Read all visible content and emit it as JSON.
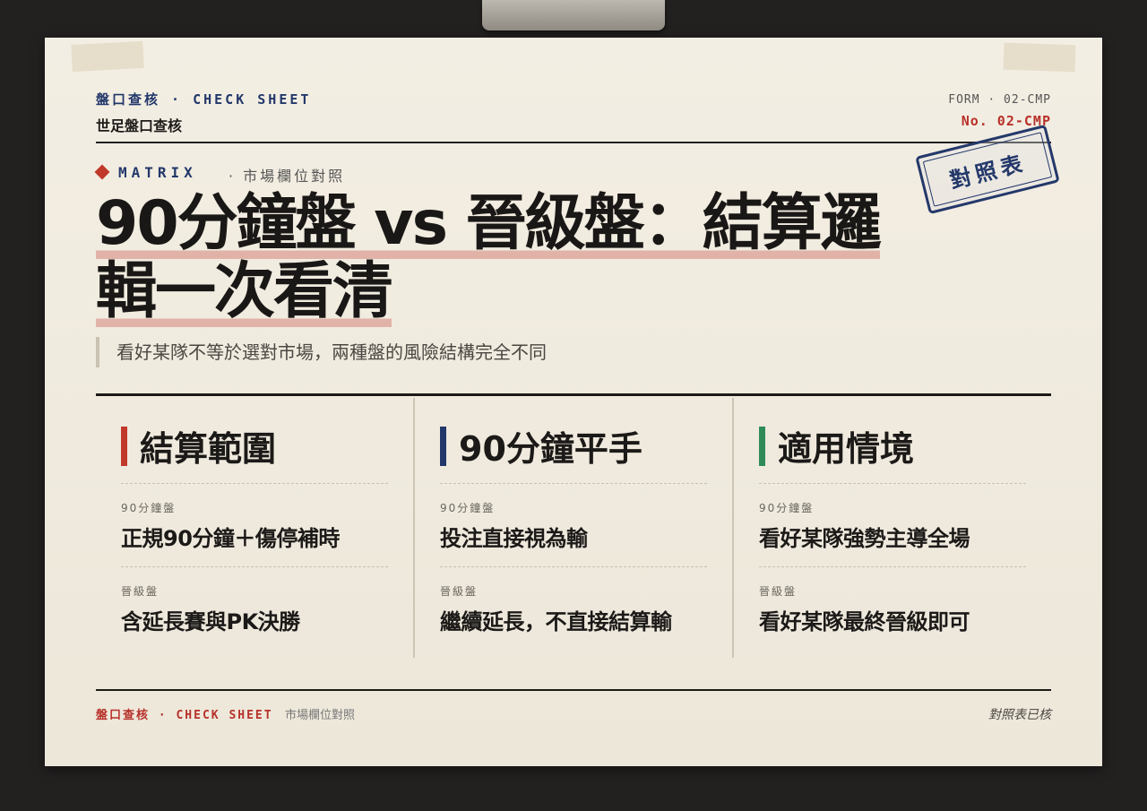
{
  "header": {
    "tag": "盤口查核 · CHECK SHEET",
    "subtitle": "世足盤口查核",
    "form_id": "FORM · 02-CMP",
    "form_no": "No. 02-CMP"
  },
  "stamp": {
    "text": "對照表"
  },
  "matrix": {
    "label": "MATRIX",
    "sub": "· 市場欄位對照"
  },
  "title": {
    "line1": "90分鐘盤 vs 晉級盤：結算邏",
    "line2": "輯一次看清"
  },
  "subtitle": "看好某隊不等於選對市場，兩種盤的風險結構完全不同",
  "columns": [
    {
      "title": "結算範圍",
      "color": "#c0392b",
      "rows": [
        {
          "label": "90分鐘盤",
          "value": "正規90分鐘＋傷停補時"
        },
        {
          "label": "晉級盤",
          "value": "含延長賽與PK決勝"
        }
      ]
    },
    {
      "title": "90分鐘平手",
      "color": "#23386a",
      "rows": [
        {
          "label": "90分鐘盤",
          "value": "投注直接視為輸"
        },
        {
          "label": "晉級盤",
          "value": "繼續延長，不直接結算輸"
        }
      ]
    },
    {
      "title": "適用情境",
      "color": "#2e8b57",
      "rows": [
        {
          "label": "90分鐘盤",
          "value": "看好某隊強勢主導全場"
        },
        {
          "label": "晉級盤",
          "value": "看好某隊最終晉級即可"
        }
      ]
    }
  ],
  "footer": {
    "tag": "盤口查核 · CHECK SHEET",
    "sub": "市場欄位對照",
    "right": "對照表已核"
  }
}
